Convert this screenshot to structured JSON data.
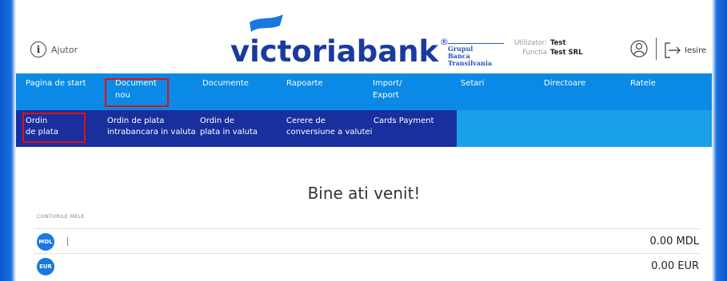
{
  "header": {
    "help_label": "Ajutor",
    "logo_text": "victoriabank",
    "logo_reg": "®",
    "group_line1": "Grupul",
    "group_line2": "Banca Transilvania",
    "user_key": "Utilizator:",
    "user_val": "Test",
    "function_key": "Functia",
    "function_val": "Test SRL",
    "logout_label": "Iesire"
  },
  "mainnav": {
    "items": [
      {
        "label": "Pagina de start"
      },
      {
        "line1": "Document",
        "line2": "nou"
      },
      {
        "label": "Documente"
      },
      {
        "label": "Rapoarte"
      },
      {
        "line1": "Import/",
        "line2": "Export"
      },
      {
        "label": "Setari"
      },
      {
        "label": "Directoare"
      },
      {
        "label": "Ratele"
      }
    ]
  },
  "subnav": {
    "items": [
      {
        "line1": "Ordin",
        "line2": "de plata"
      },
      {
        "line1": "Ordin de plata",
        "line2": "intrabancara in valuta"
      },
      {
        "line1": "Ordin de",
        "line2": "plata in valuta"
      },
      {
        "line1": "Cerere de",
        "line2": "conversiune a valutei"
      },
      {
        "label": "Cards Payment"
      }
    ]
  },
  "content": {
    "welcome": "Bine ati venit!",
    "accounts_label": "CONTURILE MELE",
    "accounts": [
      {
        "currency": "MDL",
        "amount": "0.00  MDL"
      },
      {
        "currency": "EUR",
        "amount": "0.00 EUR"
      }
    ]
  },
  "colors": {
    "main_nav": "#0a8ae6",
    "sub_nav": "#1a2f9e",
    "highlight": "#e01010",
    "brand": "#1a3a9f"
  }
}
